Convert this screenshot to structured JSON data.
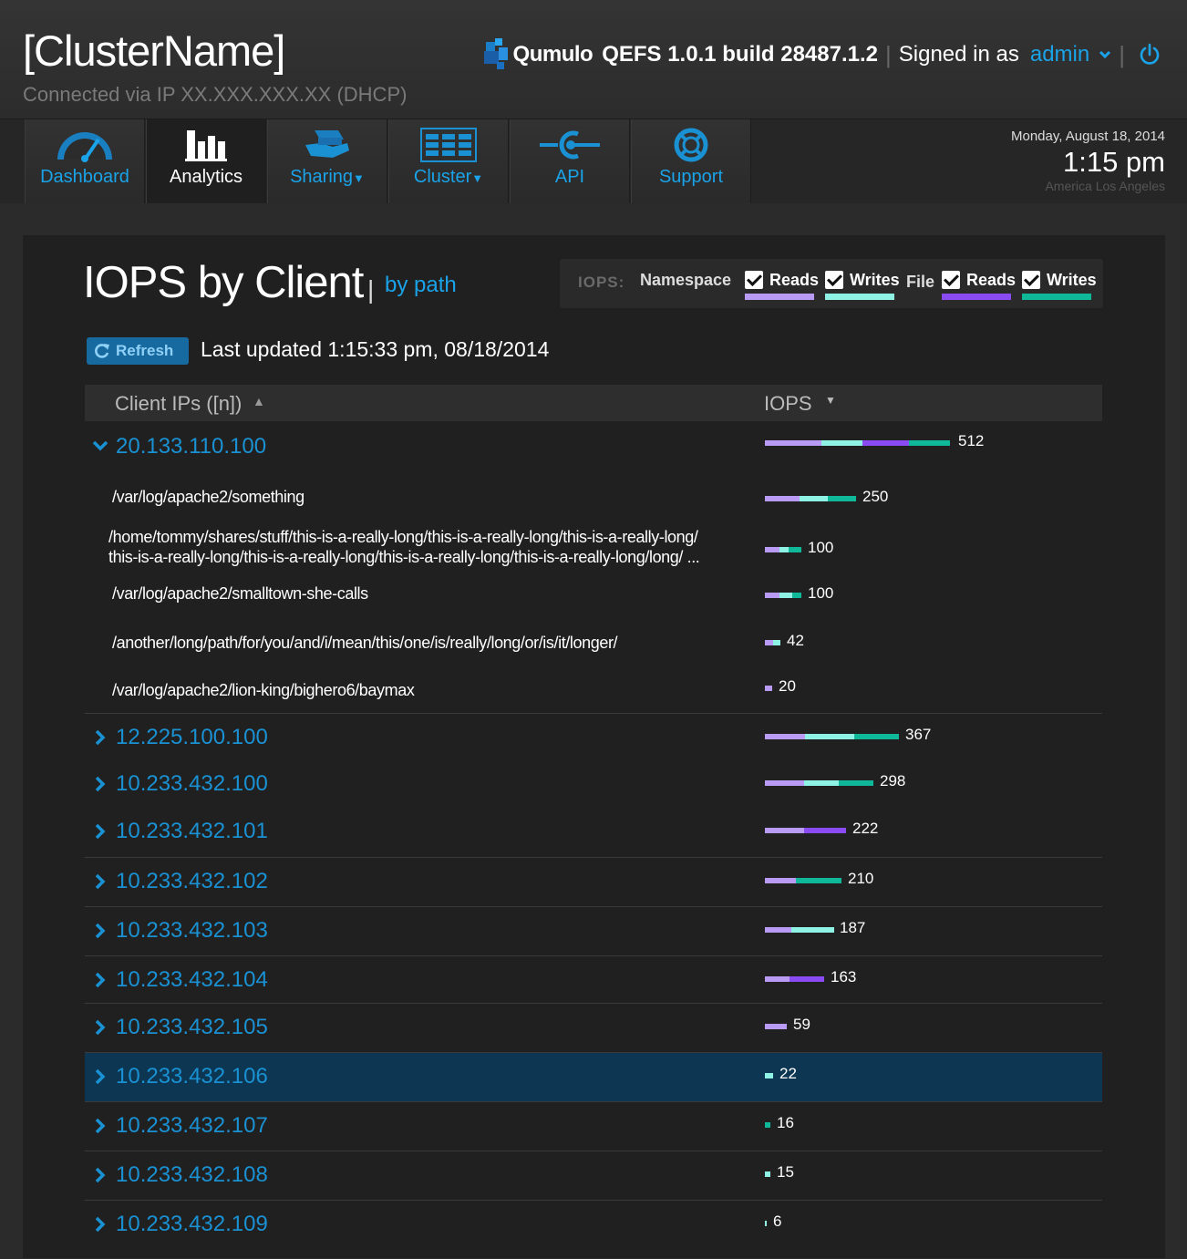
{
  "header": {
    "cluster_name": "[ClusterName]",
    "connection": "Connected via IP XX.XXX.XXX.XX (DHCP)",
    "brand": "Qumulo",
    "version": "QEFS 1.0.1 build 28487.1.2",
    "signed_in_label": "Signed in as",
    "user": "admin",
    "logo_icon": "qumulo-logo-icon",
    "power_icon": "power-icon"
  },
  "nav": {
    "tabs": [
      {
        "label": "Dashboard",
        "icon": "speedometer-icon"
      },
      {
        "label": "Analytics",
        "icon": "bar-chart-icon",
        "active": true
      },
      {
        "label": "Sharing",
        "icon": "share-hand-icon",
        "dropdown": true
      },
      {
        "label": "Cluster",
        "icon": "server-rack-icon",
        "dropdown": true
      },
      {
        "label": "API",
        "icon": "api-plug-icon"
      },
      {
        "label": "Support",
        "icon": "lifebuoy-icon"
      }
    ]
  },
  "clock": {
    "date": "Monday, August 18, 2014",
    "time": "1:15 pm",
    "zone": "America Los Angeles"
  },
  "page": {
    "title": "IOPS by Client",
    "separator": "|",
    "alt_view": "by path",
    "refresh_label": "Refresh",
    "last_updated": "Last updated 1:15:33 pm, 08/18/2014"
  },
  "legend": {
    "prefix": "IOPS:",
    "namespace_label": "Namespace",
    "file_label": "File",
    "items": [
      {
        "label": "Reads",
        "group": "Namespace",
        "checked": true,
        "color": "#b99af5"
      },
      {
        "label": "Writes",
        "group": "Namespace",
        "checked": true,
        "color": "#8ef2e4"
      },
      {
        "label": "Reads",
        "group": "File",
        "checked": true,
        "color": "#8a4cf2"
      },
      {
        "label": "Writes",
        "group": "File",
        "checked": true,
        "color": "#10b89a"
      }
    ]
  },
  "colors": {
    "ns_read": "#b99af5",
    "ns_write": "#8ef2e4",
    "file_read": "#8a4cf2",
    "file_write": "#10b89a",
    "link": "#1aa3e8"
  },
  "table": {
    "col_client": "Client IPs ([n])",
    "col_iops": "IOPS",
    "expanded_client": {
      "ip": "20.133.110.100",
      "iops": "512",
      "segments": [
        0.3,
        0.22,
        0.25,
        0.22
      ],
      "paths": [
        {
          "path": "/var/log/apache2/something",
          "iops": "250",
          "segments": [
            0.38,
            0.31,
            0,
            0.31
          ]
        },
        {
          "path": "/home/tommy/shares/stuff/this-is-a-really-long/this-is-a-really-long/this-is-a-really-long/",
          "path2": "this-is-a-really-long/this-is-a-really-long/this-is-a-really-long/this-is-a-really-long/long/ ...",
          "iops": "100",
          "segments": [
            0.4,
            0.25,
            0,
            0.35
          ]
        },
        {
          "path": "/var/log/apache2/smalltown-she-calls",
          "iops": "100",
          "segments": [
            0.4,
            0.35,
            0,
            0.25
          ]
        },
        {
          "path": "/another/long/path/for/you/and/i/mean/this/one/is/really/long/or/is/it/longer/",
          "iops": "42",
          "segments": [
            0.55,
            0.45,
            0,
            0
          ]
        },
        {
          "path": "/var/log/apache2/lion-king/bighero6/baymax",
          "iops": "20",
          "segments": [
            1,
            0,
            0,
            0
          ]
        }
      ]
    },
    "clients": [
      {
        "ip": "12.225.100.100",
        "iops": "367",
        "segments": [
          0.3,
          0.37,
          0,
          0.33
        ]
      },
      {
        "ip": "10.233.432.100",
        "iops": "298",
        "segments": [
          0.36,
          0.32,
          0,
          0.32
        ]
      },
      {
        "ip": "10.233.432.101",
        "iops": "222",
        "segments": [
          0.48,
          0,
          0.52,
          0
        ]
      },
      {
        "ip": "10.233.432.102",
        "iops": "210",
        "segments": [
          0.4,
          0,
          0,
          0.6
        ]
      },
      {
        "ip": "10.233.432.103",
        "iops": "187",
        "segments": [
          0.38,
          0.62,
          0,
          0
        ]
      },
      {
        "ip": "10.233.432.104",
        "iops": "163",
        "segments": [
          0.42,
          0,
          0.58,
          0
        ]
      },
      {
        "ip": "10.233.432.105",
        "iops": "59",
        "segments": [
          1,
          0,
          0,
          0
        ]
      },
      {
        "ip": "10.233.432.106",
        "iops": "22",
        "segments": [
          0,
          1,
          0,
          0
        ],
        "selected": true
      },
      {
        "ip": "10.233.432.107",
        "iops": "16",
        "segments": [
          0,
          0,
          0,
          1
        ]
      },
      {
        "ip": "10.233.432.108",
        "iops": "15",
        "segments": [
          0,
          1,
          0,
          0
        ]
      },
      {
        "ip": "10.233.432.109",
        "iops": "6",
        "segments": [
          0,
          1,
          0,
          0
        ]
      }
    ]
  }
}
